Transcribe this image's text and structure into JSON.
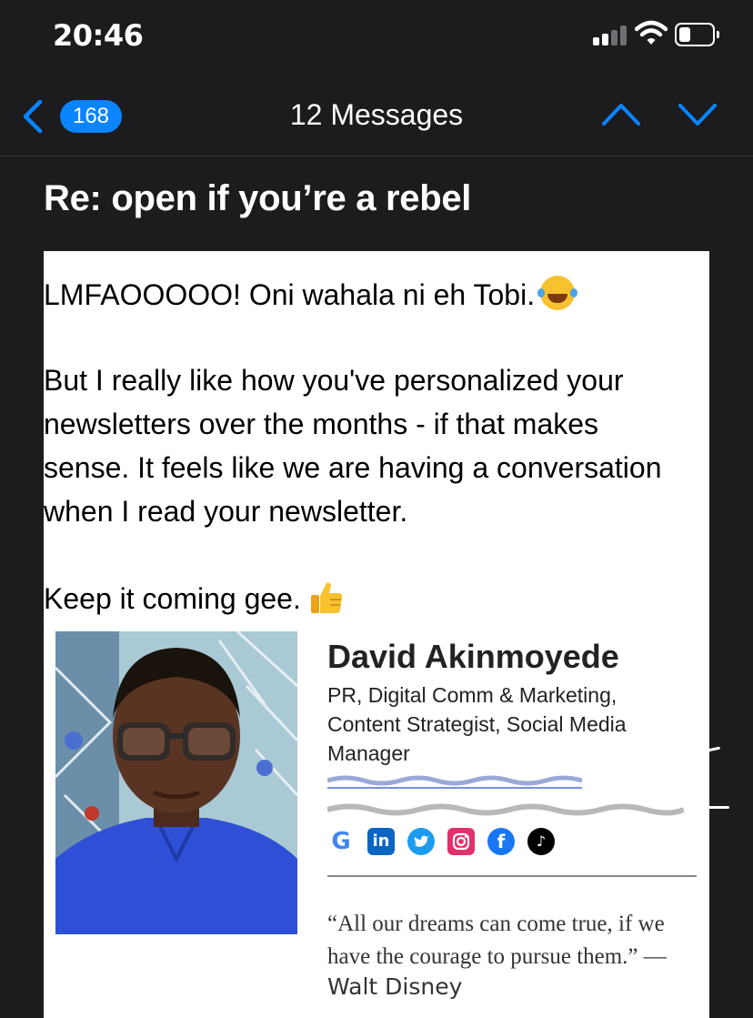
{
  "status_bar": {
    "time": "20:46",
    "signal_icon": "cellular-signal-icon",
    "wifi_icon": "wifi-icon",
    "battery_icon": "battery-icon",
    "battery_level": 0.25
  },
  "nav": {
    "back_icon": "chevron-left-icon",
    "badge_count": "168",
    "title": "12 Messages",
    "prev_icon": "chevron-up-icon",
    "next_icon": "chevron-down-icon",
    "accent_color": "#0a84ff"
  },
  "message": {
    "subject": "Re: open if you’re a rebel",
    "paragraph1": "LMFAOOOOO! Oni wahala ni eh Tobi.",
    "paragraph1_emoji": "face-with-tears-of-joy-emoji",
    "paragraph2_lines": [
      "But I really like how you've personalized your",
      "newsletters over the months - if that makes",
      "sense. It feels like we are having a conversation",
      "when I read your newsletter."
    ],
    "paragraph3": "Keep it coming gee.",
    "paragraph3_emoji": "thumbs-up-emoji"
  },
  "signature": {
    "photo": "profile-photo",
    "name": "David Akinmoyede",
    "role_lines": [
      "PR, Digital Comm & Marketing,",
      "Content Strategist, Social Media",
      "Manager"
    ],
    "social_icons": [
      "google-icon",
      "linkedin-icon",
      "twitter-icon",
      "instagram-icon",
      "facebook-icon",
      "tiktok-icon"
    ],
    "quote_lines": [
      "“All our dreams can come true, if we",
      "have the courage to pursue them.” —"
    ],
    "quote_author": "Walt Disney"
  }
}
